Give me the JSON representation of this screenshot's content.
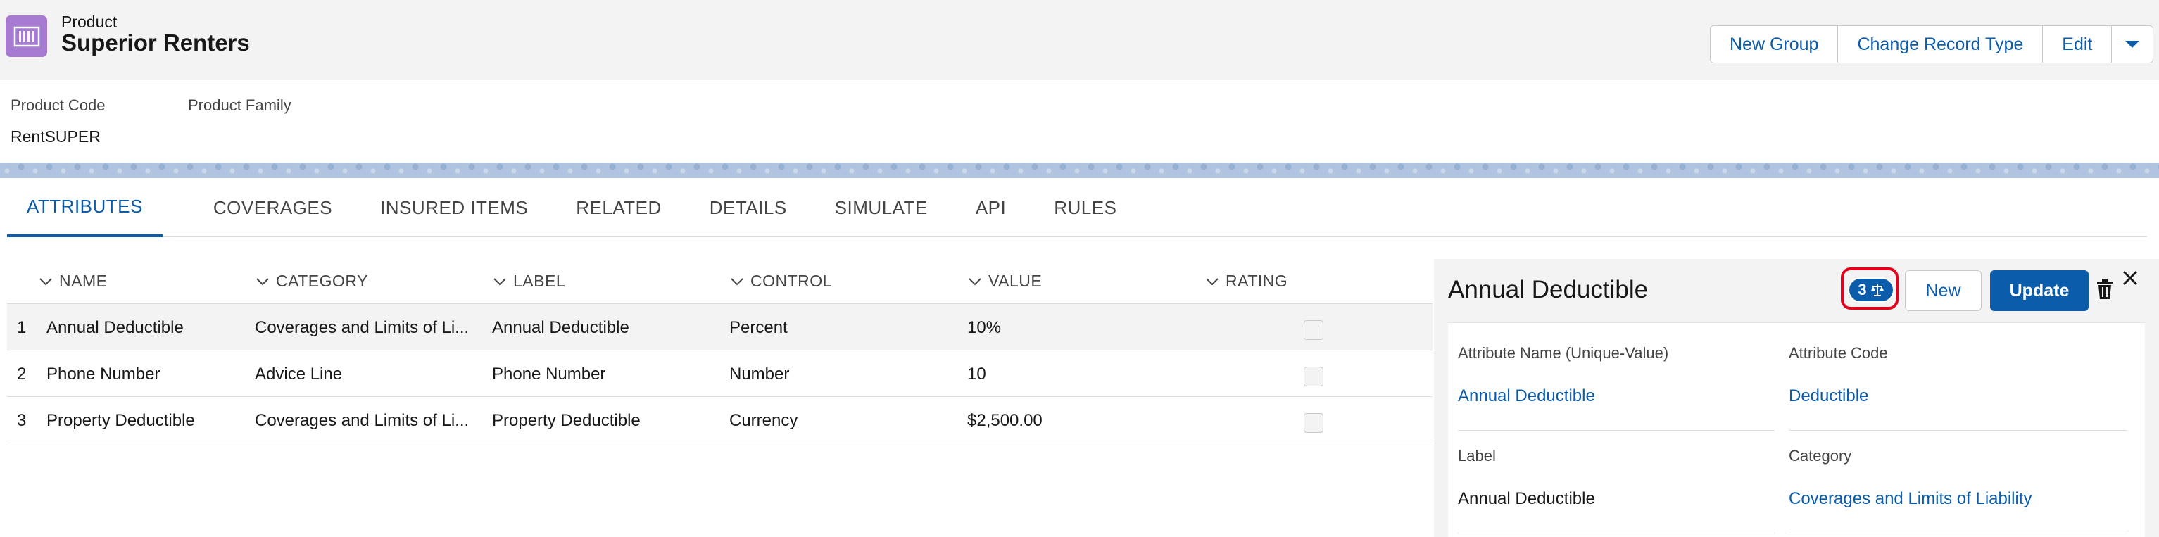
{
  "header": {
    "entity_type": "Product",
    "title": "Superior Renters",
    "actions": [
      "New Group",
      "Change Record Type",
      "Edit"
    ]
  },
  "highlights": [
    {
      "label": "Product Code",
      "value": "RentSUPER"
    },
    {
      "label": "Product Family",
      "value": ""
    }
  ],
  "tabs": [
    "ATTRIBUTES",
    "COVERAGES",
    "INSURED ITEMS",
    "RELATED",
    "DETAILS",
    "SIMULATE",
    "API",
    "RULES"
  ],
  "active_tab": "ATTRIBUTES",
  "table": {
    "columns": [
      "NAME",
      "CATEGORY",
      "LABEL",
      "CONTROL",
      "VALUE",
      "RATING"
    ],
    "rows": [
      {
        "num": "1",
        "name": "Annual Deductible",
        "category": "Coverages and Limits of Li...",
        "label": "Annual Deductible",
        "control": "Percent",
        "value": "10%",
        "rating": false
      },
      {
        "num": "2",
        "name": "Phone Number",
        "category": "Advice Line",
        "label": "Phone Number",
        "control": "Number",
        "value": "10",
        "rating": false
      },
      {
        "num": "3",
        "name": "Property Deductible",
        "category": "Coverages and Limits of Li...",
        "label": "Property Deductible",
        "control": "Currency",
        "value": "$2,500.00",
        "rating": false
      }
    ]
  },
  "panel": {
    "title": "Annual Deductible",
    "version_count": "3",
    "new_label": "New",
    "update_label": "Update",
    "fields": [
      {
        "label": "Attribute Name (Unique-Value)",
        "value": "Annual Deductible",
        "link": true
      },
      {
        "label": "Attribute Code",
        "value": "Deductible",
        "link": true
      },
      {
        "label": "Label",
        "value": "Annual Deductible",
        "link": false
      },
      {
        "label": "Category",
        "value": "Coverages and Limits of Liability",
        "link": true
      }
    ]
  },
  "colors": {
    "brand_blue": "#0b5cab",
    "product_icon": "#a77bd1",
    "highlight_ring": "#e3001b"
  }
}
